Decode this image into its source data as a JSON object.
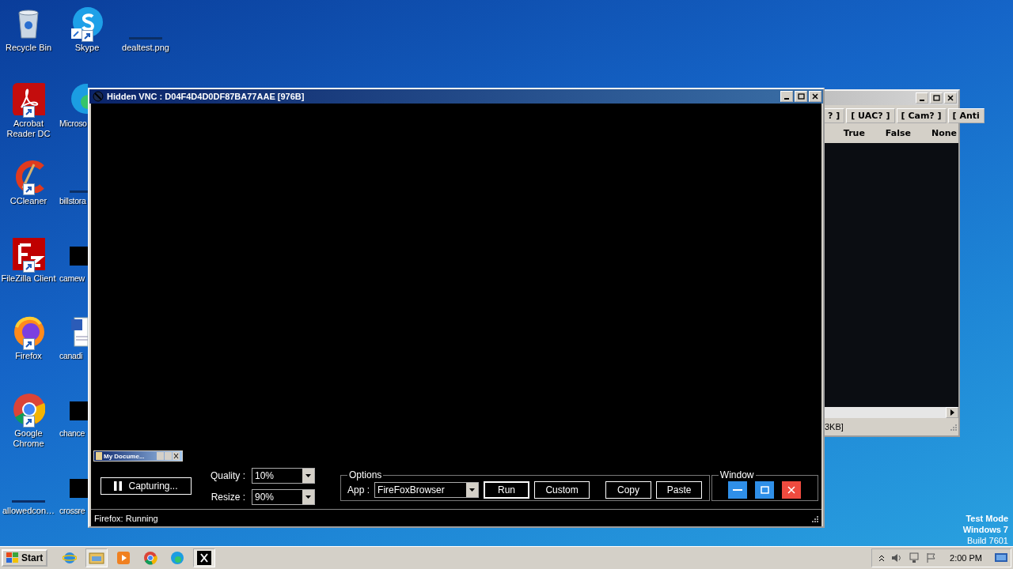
{
  "desktop_icons": [
    {
      "label": "Recycle Bin",
      "kind": "recycle"
    },
    {
      "label": "Skype",
      "kind": "skype"
    },
    {
      "label": "dealtest.png",
      "kind": "blank"
    },
    {
      "label": "Acrobat Reader DC",
      "kind": "acrobat"
    },
    {
      "label": "Microso",
      "kind": "edge"
    },
    {
      "label": "CCleaner",
      "kind": "ccleaner"
    },
    {
      "label": "billstora",
      "kind": "blank"
    },
    {
      "label": "FileZilla Client",
      "kind": "filezilla"
    },
    {
      "label": "camew",
      "kind": "thumb"
    },
    {
      "label": "Firefox",
      "kind": "firefox"
    },
    {
      "label": "canadi",
      "kind": "word"
    },
    {
      "label": "Google Chrome",
      "kind": "chrome"
    },
    {
      "label": "chance",
      "kind": "thumb"
    },
    {
      "label": "allowedcon…",
      "kind": "blank"
    },
    {
      "label": "crossre",
      "kind": "thumb"
    }
  ],
  "back_window": {
    "header_cells": [
      "? ]",
      "[ UAC? ]",
      "[ Cam? ]",
      "[ Anti"
    ],
    "row": [
      "True",
      "False",
      "None"
    ],
    "status": "3KB]"
  },
  "vnc_window": {
    "title": "Hidden VNC : D04F4D4D0DF87BA77AAE [976B]",
    "mini_window": {
      "title": "My Docume..."
    },
    "capture_button": "Capturing...",
    "quality": {
      "label": "Quality :",
      "value": "10%"
    },
    "resize": {
      "label": "Resize :",
      "value": "90%"
    },
    "options": {
      "legend": "Options",
      "app_label": "App :",
      "app_value": "FireFoxBrowser",
      "buttons": [
        "Run",
        "Custom",
        "Copy",
        "Paste"
      ]
    },
    "window_group": {
      "legend": "Window"
    },
    "status": "Firefox: Running"
  },
  "test_mode": [
    "Test Mode",
    "Windows 7",
    "Build 7601"
  ],
  "taskbar": {
    "start": "Start",
    "apps": [
      {
        "kind": "ie"
      },
      {
        "kind": "explorer"
      },
      {
        "kind": "media"
      },
      {
        "kind": "chrome"
      },
      {
        "kind": "edge"
      },
      {
        "kind": "x"
      }
    ],
    "clock": "2:00 PM"
  }
}
